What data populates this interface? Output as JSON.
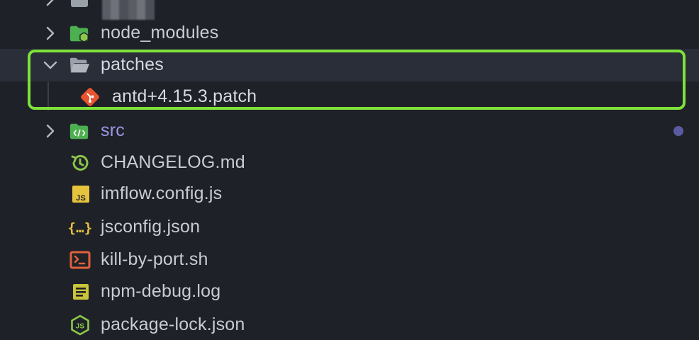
{
  "colors": {
    "background": "#1f2128",
    "text": "#c9ccd3",
    "modified_text": "#9b98e8",
    "highlight_border": "#7ee23a",
    "git_dot": "#5b5aa0",
    "folder_green": "#4caf50",
    "folder_gray": "#9aa0a8",
    "patch_red": "#e8542e",
    "js_yellow": "#e6c33d",
    "json_yellow": "#e6c33d",
    "sh_orange": "#e0623a",
    "log_yellow": "#c9c43a",
    "node_green": "#8cc84b",
    "changelog_green": "#8bc34a"
  },
  "tree": {
    "items": [
      {
        "label": "",
        "icon": "folder-icon",
        "expanded": false
      },
      {
        "label": "node_modules",
        "icon": "node-folder-icon",
        "expanded": false
      },
      {
        "label": "patches",
        "icon": "open-folder-icon",
        "expanded": true
      },
      {
        "label": "antd+4.15.3.patch",
        "icon": "git-patch-icon"
      },
      {
        "label": "src",
        "icon": "src-folder-icon",
        "expanded": false,
        "status": "modified"
      },
      {
        "label": "CHANGELOG.md",
        "icon": "history-icon"
      },
      {
        "label": "imflow.config.js",
        "icon": "js-file-icon",
        "icon_text": "JS"
      },
      {
        "label": "jsconfig.json",
        "icon": "json-braces-icon",
        "icon_text": "{...}"
      },
      {
        "label": "kill-by-port.sh",
        "icon": "terminal-icon"
      },
      {
        "label": "npm-debug.log",
        "icon": "log-file-icon"
      },
      {
        "label": "package-lock.json",
        "icon": "nodejs-hexagon-icon",
        "icon_text": "JS"
      }
    ]
  }
}
